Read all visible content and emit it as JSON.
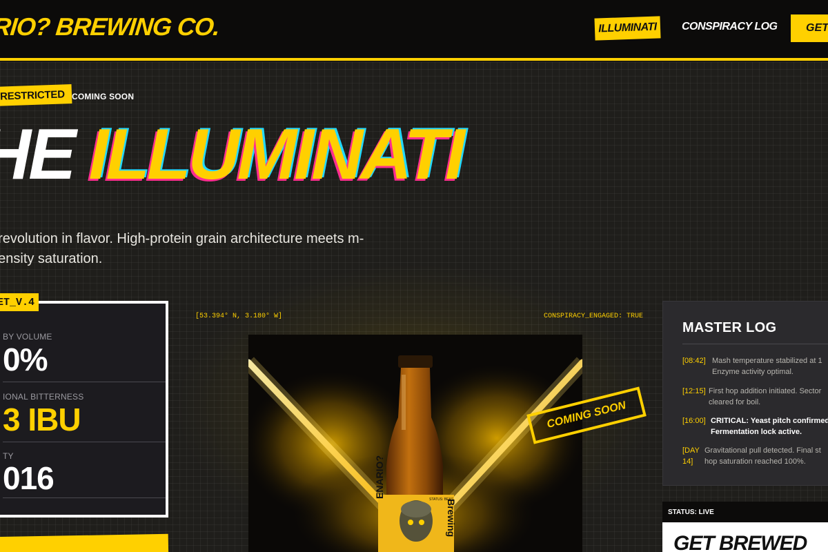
{
  "header": {
    "brand": "NARIO? BREWING CO.",
    "nav": {
      "illuminati": "ILLUMINATI",
      "conspiracy_log": "CONSPIRACY LOG",
      "cta": "GET B"
    }
  },
  "hero": {
    "badge_restricted": "RESTRICTED",
    "badge_status": "COMING SOON",
    "title_part1": "HE",
    "title_part2": "ILLUMINATI",
    "description": "f revolution in flavor. High-protein grain architecture meets m-density saturation."
  },
  "spec_card": {
    "tag": "ET_V.4",
    "rows": [
      {
        "label": "BY VOLUME",
        "value": "0%",
        "highlight": false
      },
      {
        "label": "IONAL BITTERNESS",
        "value": "3 IBU",
        "highlight": true
      },
      {
        "label": "TY",
        "value": "016",
        "highlight": false
      }
    ]
  },
  "product": {
    "coordinates": "[53.394° N, 3.180° W]",
    "engaged": "CONSPIRACY_ENGAGED: TRUE",
    "stamp": "COMING SOON",
    "bottle_label_side_left": "ENARIO?",
    "bottle_label_side_right": "Brewing",
    "bottle_label_tiny": "STATUS: BEAS"
  },
  "master_log": {
    "title": "MASTER LOG",
    "entries": [
      {
        "time": "[08:42]",
        "message": "Mash temperature stabilized at 1 Enzyme activity optimal.",
        "critical": false
      },
      {
        "time": "[12:15]",
        "message": "First hop addition initiated. Sector cleared for boil.",
        "critical": false
      },
      {
        "time": "[16:00]",
        "message": "CRITICAL: Yeast pitch confirmed. Fermentation lock active.",
        "critical": true
      },
      {
        "time": "[DAY 14]",
        "message": "Gravitational pull detected. Final st hop saturation reached 100%.",
        "critical": false
      }
    ]
  },
  "status": {
    "label": "STATUS: LIVE",
    "cta_title": "GET BREWED"
  },
  "colors": {
    "accent": "#ffd000",
    "background": "#1f1e1b",
    "header": "#0c0b0a",
    "panel": "#2b2a2d"
  }
}
